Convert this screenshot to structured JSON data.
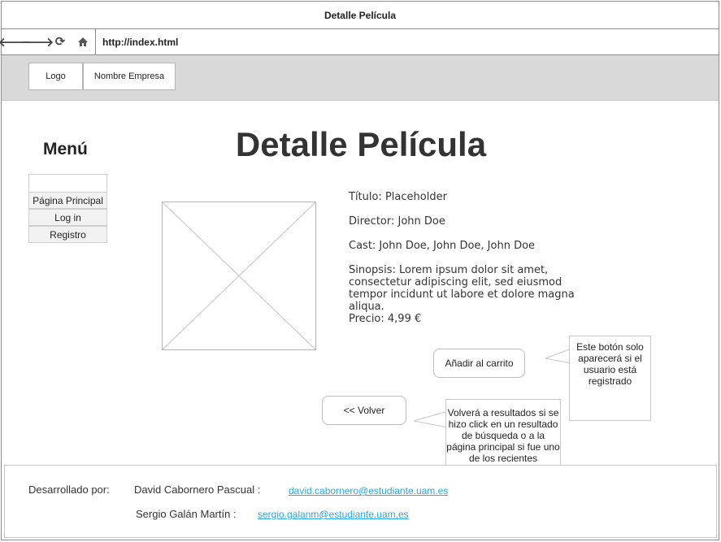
{
  "window": {
    "title": "Detalle Película"
  },
  "browser": {
    "url": "http://index.html",
    "icons": [
      "back-arrow-icon",
      "forward-arrow-icon",
      "refresh-icon",
      "home-icon"
    ]
  },
  "header": {
    "logo": "Logo",
    "company": "Nombre Empresa"
  },
  "menu": {
    "title": "Menú",
    "items": [
      {
        "label": "Página Principal"
      },
      {
        "label": "Log in"
      },
      {
        "label": "Registro"
      }
    ]
  },
  "page": {
    "title": "Detalle Película"
  },
  "movie": {
    "title_line": "Título: Placeholder",
    "director_line": "Director: John Doe",
    "cast_line": "Cast: John Doe, John Doe, John Doe",
    "synopsis_line": "Sinopsis: Lorem ipsum dolor sit amet, consectetur adipiscing elit, sed eiusmod tempor incidunt ut labore et dolore magna aliqua.",
    "price_line": "Precio: 4,99 €"
  },
  "actions": {
    "add_to_cart": "Añadir al carrito",
    "back": "<< Volver"
  },
  "notes": {
    "cart_note": "Este botón solo aparecerá si el usuario está registrado",
    "back_note": "Volverá a resultados si se hizo click en un resultado de búsqueda o a la página principal si fue uno de los recientes"
  },
  "footer": {
    "developed_by": "Desarrollado por:",
    "devs": [
      {
        "name": "David Cabornero Pascual :",
        "email": "david.cabornero@estudiante.uam.es"
      },
      {
        "name": "Sergio Galán Martín :",
        "email": "sergio.galanm@estudiante.uam.es"
      }
    ]
  },
  "colors": {
    "header_bg": "#d9d9d9",
    "link": "#2aa6e0",
    "border": "#b5b5b5"
  }
}
